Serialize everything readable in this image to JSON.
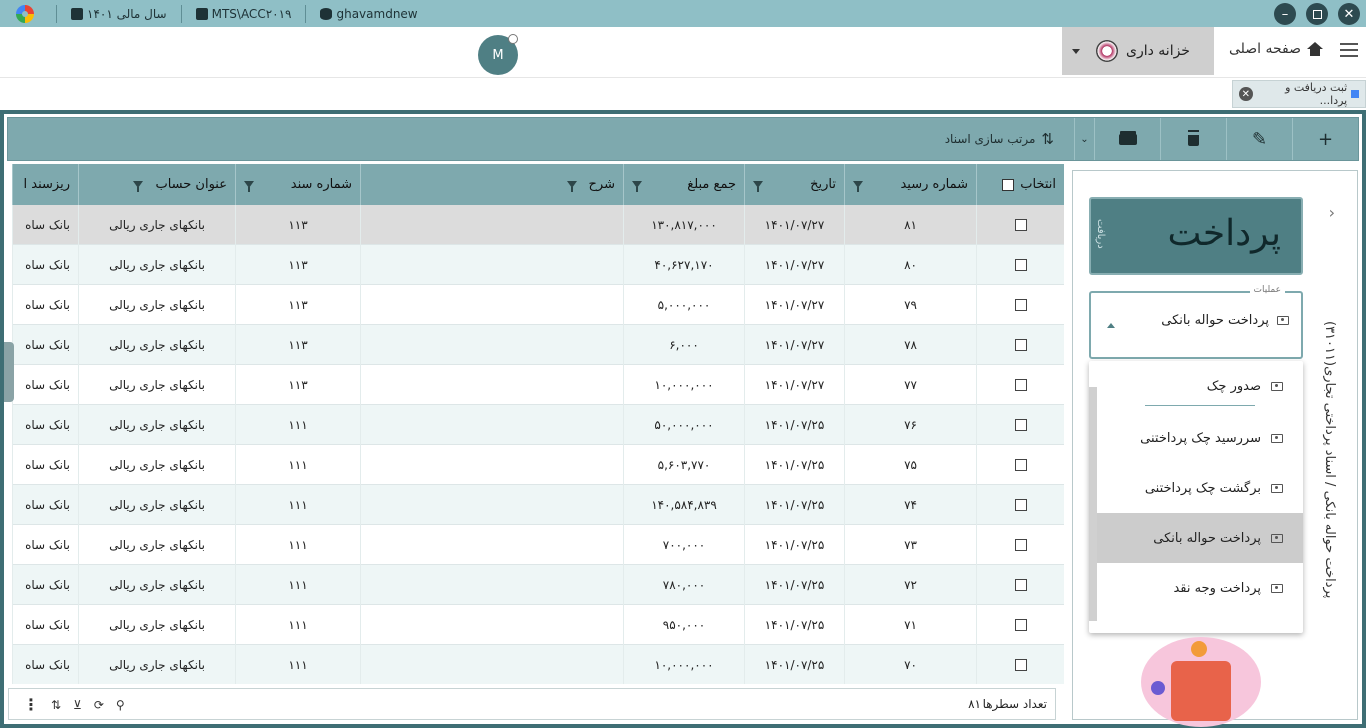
{
  "titlebar": {
    "fiscal_year": "سال مالی ۱۴۰۱",
    "server": "MTS\\ACC۲۰۱۹",
    "database": "ghavamdnew"
  },
  "topnav": {
    "home_label": "صفحه اصلی",
    "module_label": "خزانه داری",
    "user_initial": "M"
  },
  "tab": {
    "label": "ثبت دریافت و پردا..."
  },
  "toolbar": {
    "sort_label": "مرتب سازی اسناد"
  },
  "grid": {
    "columns": [
      "انتخاب",
      "شماره رسید",
      "تاریخ",
      "جمع مبلغ",
      "شرح",
      "شماره سند",
      "عنوان حساب",
      "ریزسند ا"
    ],
    "rows": [
      {
        "num": "۸۱",
        "date": "۱۴۰۱/۰۷/۲۷",
        "amount": "۱۳۰,۸۱۷,۰۰۰",
        "desc": "",
        "doc": "۱۱۳",
        "account": "بانکهای جاری ریالی",
        "sub": "بانک ساه"
      },
      {
        "num": "۸۰",
        "date": "۱۴۰۱/۰۷/۲۷",
        "amount": "۴۰,۶۲۷,۱۷۰",
        "desc": "",
        "doc": "۱۱۳",
        "account": "بانکهای جاری ریالی",
        "sub": "بانک ساه"
      },
      {
        "num": "۷۹",
        "date": "۱۴۰۱/۰۷/۲۷",
        "amount": "۵,۰۰۰,۰۰۰",
        "desc": "",
        "doc": "۱۱۳",
        "account": "بانکهای جاری ریالی",
        "sub": "بانک ساه"
      },
      {
        "num": "۷۸",
        "date": "۱۴۰۱/۰۷/۲۷",
        "amount": "۶,۰۰۰",
        "desc": "",
        "doc": "۱۱۳",
        "account": "بانکهای جاری ریالی",
        "sub": "بانک ساه"
      },
      {
        "num": "۷۷",
        "date": "۱۴۰۱/۰۷/۲۷",
        "amount": "۱۰,۰۰۰,۰۰۰",
        "desc": "",
        "doc": "۱۱۳",
        "account": "بانکهای جاری ریالی",
        "sub": "بانک ساه"
      },
      {
        "num": "۷۶",
        "date": "۱۴۰۱/۰۷/۲۵",
        "amount": "۵۰,۰۰۰,۰۰۰",
        "desc": "",
        "doc": "۱۱۱",
        "account": "بانکهای جاری ریالی",
        "sub": "بانک ساه"
      },
      {
        "num": "۷۵",
        "date": "۱۴۰۱/۰۷/۲۵",
        "amount": "۵,۶۰۳,۷۷۰",
        "desc": "",
        "doc": "۱۱۱",
        "account": "بانکهای جاری ریالی",
        "sub": "بانک ساه"
      },
      {
        "num": "۷۴",
        "date": "۱۴۰۱/۰۷/۲۵",
        "amount": "۱۴۰,۵۸۴,۸۳۹",
        "desc": "",
        "doc": "۱۱۱",
        "account": "بانکهای جاری ریالی",
        "sub": "بانک ساه"
      },
      {
        "num": "۷۳",
        "date": "۱۴۰۱/۰۷/۲۵",
        "amount": "۷۰۰,۰۰۰",
        "desc": "",
        "doc": "۱۱۱",
        "account": "بانکهای جاری ریالی",
        "sub": "بانک ساه"
      },
      {
        "num": "۷۲",
        "date": "۱۴۰۱/۰۷/۲۵",
        "amount": "۷۸۰,۰۰۰",
        "desc": "",
        "doc": "۱۱۱",
        "account": "بانکهای جاری ریالی",
        "sub": "بانک ساه"
      },
      {
        "num": "۷۱",
        "date": "۱۴۰۱/۰۷/۲۵",
        "amount": "۹۵۰,۰۰۰",
        "desc": "",
        "doc": "۱۱۱",
        "account": "بانکهای جاری ریالی",
        "sub": "بانک ساه"
      },
      {
        "num": "۷۰",
        "date": "۱۴۰۱/۰۷/۲۵",
        "amount": "۱۰,۰۰۰,۰۰۰",
        "desc": "",
        "doc": "۱۱۱",
        "account": "بانکهای جاری ریالی",
        "sub": "بانک ساه"
      }
    ]
  },
  "footer": {
    "row_count_label": "تعداد سطرها",
    "row_count": "۸۱"
  },
  "panel": {
    "vertical_title": "پرداخت حواله بانکی / اسناد پرداختی تجاری(۳۱۰۱۱)",
    "card_title": "پرداخت",
    "card_tag": "دریافت",
    "ops_legend": "عملیات",
    "ops_value": "پرداخت حواله بانکی",
    "options": [
      "صدور چک",
      "سررسید چک پرداختنی",
      "برگشت چک پرداختنی",
      "پرداخت حواله بانکی",
      "پرداخت وجه نقد"
    ]
  }
}
